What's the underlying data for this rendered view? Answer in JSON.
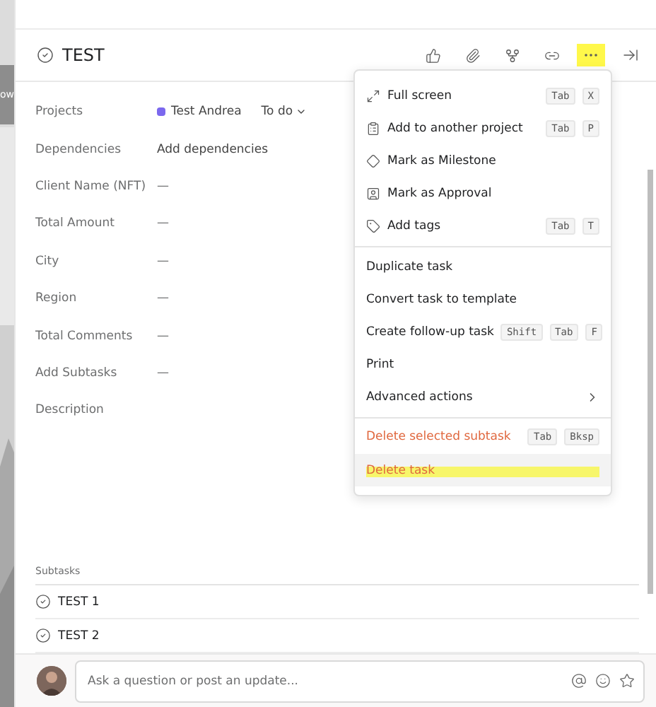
{
  "edge_tab": {
    "label": "ow"
  },
  "task": {
    "title": "TEST"
  },
  "more_button": {
    "highlighted": true
  },
  "fields": [
    {
      "label": "Projects",
      "kind": "project",
      "project": "Test Andrea",
      "color": "#7b68ee",
      "status": "To do"
    },
    {
      "label": "Dependencies",
      "kind": "link",
      "value": "Add dependencies"
    },
    {
      "label": "Client Name (NFT)",
      "kind": "text",
      "value": "—"
    },
    {
      "label": "Total Amount",
      "kind": "text",
      "value": "—"
    },
    {
      "label": "City",
      "kind": "text",
      "value": "—"
    },
    {
      "label": "Region",
      "kind": "text",
      "value": "—"
    },
    {
      "label": "Total Comments",
      "kind": "text",
      "value": "—"
    },
    {
      "label": "Add Subtasks",
      "kind": "text",
      "value": "—"
    },
    {
      "label": "Description",
      "kind": "empty"
    }
  ],
  "subtasks": {
    "title": "Subtasks",
    "items": [
      {
        "name": "TEST 1"
      },
      {
        "name": "TEST 2"
      }
    ]
  },
  "comment": {
    "placeholder": "Ask a question or post an update..."
  },
  "menu": {
    "sections": [
      [
        {
          "label": "Full screen",
          "keys": [
            "Tab",
            "X"
          ]
        },
        {
          "label": "Add to another project",
          "keys": [
            "Tab",
            "P"
          ]
        },
        {
          "label": "Mark as Milestone"
        },
        {
          "label": "Mark as Approval"
        },
        {
          "label": "Add tags",
          "keys": [
            "Tab",
            "T"
          ]
        }
      ],
      [
        {
          "label": "Duplicate task"
        },
        {
          "label": "Convert task to template"
        },
        {
          "label": "Create follow-up task",
          "keys": [
            "Shift",
            "Tab",
            "F"
          ]
        },
        {
          "label": "Print"
        },
        {
          "label": "Advanced actions",
          "submenu": true
        }
      ],
      [
        {
          "label": "Delete selected subtask",
          "danger": true,
          "keys": [
            "Tab",
            "Bksp"
          ]
        },
        {
          "label": "Delete task",
          "danger": true,
          "hovered": true,
          "highlighted": true
        }
      ]
    ]
  }
}
